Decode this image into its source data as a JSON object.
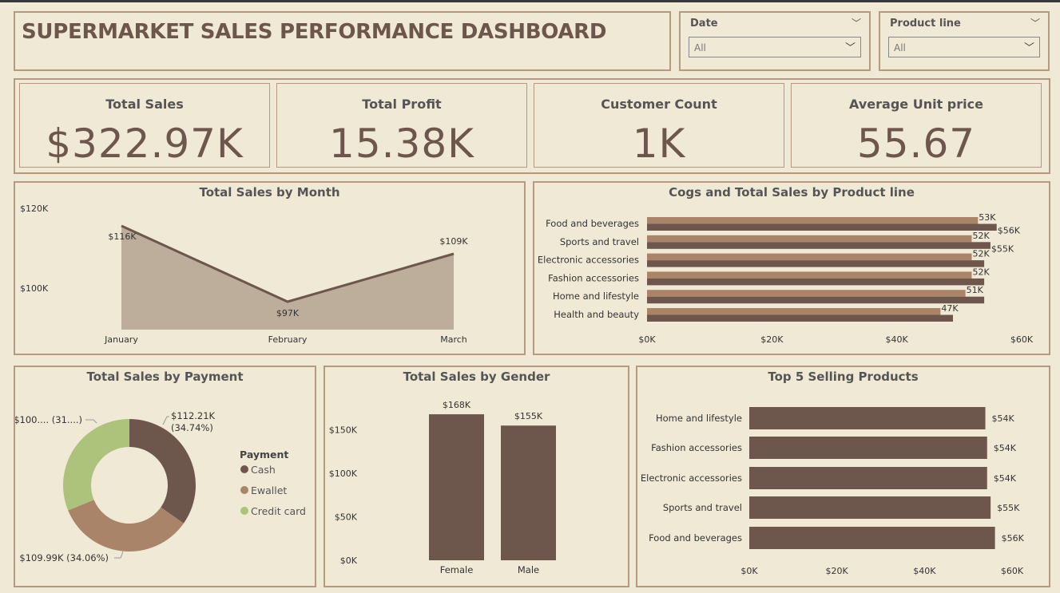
{
  "header": {
    "title": "SUPERMARKET SALES PERFORMANCE DASHBOARD"
  },
  "filters": {
    "date": {
      "label": "Date",
      "value": "All"
    },
    "product_line": {
      "label": "Product line",
      "value": "All"
    }
  },
  "kpis": [
    {
      "label": "Total Sales",
      "value": "$322.97K"
    },
    {
      "label": "Total Profit",
      "value": "15.38K"
    },
    {
      "label": "Customer Count",
      "value": "1K"
    },
    {
      "label": "Average Unit price",
      "value": "55.67"
    }
  ],
  "colors": {
    "dark_brown": "#6d574d",
    "light_brown": "#a98468",
    "taupe_area": "#bcae9b",
    "green": "#adc27a",
    "panel_border": "#b39a80",
    "background": "#f0e9d6"
  },
  "chart_data": [
    {
      "id": "sales_by_month",
      "type": "area",
      "title": "Total Sales by Month",
      "categories": [
        "January",
        "February",
        "March"
      ],
      "values": [
        116,
        97,
        109
      ],
      "data_labels": [
        "$116K",
        "$97K",
        "$109K"
      ],
      "y_ticks": [
        {
          "value": 100,
          "label": "$100K"
        },
        {
          "value": 120,
          "label": "$120K"
        }
      ],
      "ylim": [
        90,
        120
      ]
    },
    {
      "id": "cogs_sales_by_product",
      "type": "bar",
      "orientation": "horizontal",
      "title": "Cogs and Total Sales by Product line",
      "categories": [
        "Food and beverages",
        "Sports and travel",
        "Electronic accessories",
        "Fashion accessories",
        "Home and lifestyle",
        "Health and beauty"
      ],
      "series": [
        {
          "values": [
            53,
            52,
            52,
            52,
            51,
            47
          ],
          "labels": [
            "53K",
            "52K",
            "52K",
            "52K",
            "51K",
            "47K"
          ]
        },
        {
          "values": [
            56,
            55,
            54,
            54,
            54,
            49
          ],
          "labels": [
            "$56K",
            "$55K",
            "",
            "",
            "",
            ""
          ]
        }
      ],
      "x_ticks": [
        "$0K",
        "$20K",
        "$40K",
        "$60K"
      ],
      "xlim": [
        0,
        60
      ]
    },
    {
      "id": "sales_by_payment",
      "type": "pie",
      "title": "Total Sales by Payment",
      "legend_title": "Payment",
      "legend_position": "right",
      "slices": [
        {
          "name": "Cash",
          "value": 112.21,
          "percent": 34.74,
          "label_value": "$112.21K",
          "label_percent": "(34.74%)"
        },
        {
          "name": "Ewallet",
          "value": 109.99,
          "percent": 34.06,
          "label": "$109.99K (34.06%)"
        },
        {
          "name": "Credit card",
          "value": 100.77,
          "percent": 31.2,
          "label": "$100.... (31....)"
        }
      ]
    },
    {
      "id": "sales_by_gender",
      "type": "bar",
      "title": "Total Sales by Gender",
      "categories": [
        "Female",
        "Male"
      ],
      "values": [
        168,
        155
      ],
      "data_labels": [
        "$168K",
        "$155K"
      ],
      "y_ticks": [
        "$0K",
        "$50K",
        "$100K",
        "$150K"
      ],
      "ylim": [
        0,
        180
      ]
    },
    {
      "id": "top5_products",
      "type": "bar",
      "orientation": "horizontal",
      "title": "Top 5 Selling Products",
      "categories": [
        "Home and lifestyle",
        "Fashion accessories",
        "Electronic accessories",
        "Sports and travel",
        "Food and beverages"
      ],
      "values": [
        53.9,
        54.3,
        54.3,
        55.1,
        56.1
      ],
      "data_labels": [
        "$54K",
        "$54K",
        "$54K",
        "$55K",
        "$56K"
      ],
      "x_ticks": [
        "$0K",
        "$20K",
        "$40K",
        "$60K"
      ],
      "xlim": [
        0,
        60
      ]
    }
  ]
}
